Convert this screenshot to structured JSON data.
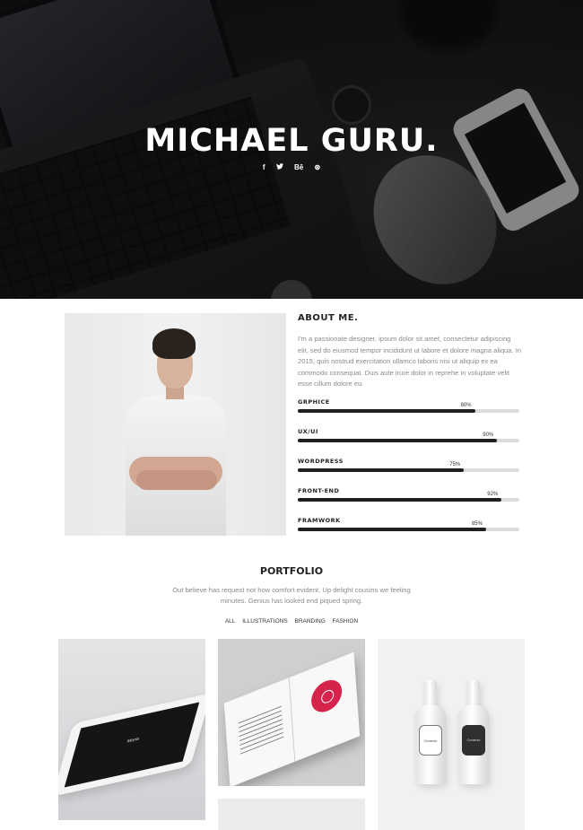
{
  "hero": {
    "title": "MICHAEL GURU.",
    "socials": [
      {
        "icon": "facebook-icon",
        "glyph": "f"
      },
      {
        "icon": "twitter-icon",
        "glyph": "🐦"
      },
      {
        "icon": "behance-icon",
        "glyph": "Bē"
      },
      {
        "icon": "dribbble-icon",
        "glyph": "⊛"
      }
    ]
  },
  "about": {
    "title": "ABOUT ME.",
    "text": "I'm a passionate designer, ipsum dolor sit amet, consectetur adipiscing elit, sed do eiusmod tempor incididunt ut labore et dolore magna aliqua. In 2015, quis nostrud exercitation ullamco laboris nisi ut aliquip ex ea commodo consequat. Duis aute irure dolor in reprehe in voluptate velit esse cillum dolore eu.",
    "skills": [
      {
        "name": "GRPHICE",
        "percent": 80,
        "label": "80%"
      },
      {
        "name": "UX/UI",
        "percent": 90,
        "label": "90%"
      },
      {
        "name": "WORDPRESS",
        "percent": 75,
        "label": "75%"
      },
      {
        "name": "FRONT-END",
        "percent": 92,
        "label": "92%"
      },
      {
        "name": "FRAMWORK",
        "percent": 85,
        "label": "85%"
      }
    ]
  },
  "portfolio": {
    "title": "PORTFOLIO",
    "description": "Out believe has request not how comfort evident. Up delight cousins we feeling minutes. Genius has looked end piqued spring.",
    "filters": [
      "ALL",
      "ILLUSTRATIONS",
      "BRANDING",
      "FASHION"
    ],
    "items": {
      "tablet_label": "Marie",
      "bottle_1_label": "Ceramic",
      "bottle_2_label": "Ceramic"
    }
  }
}
